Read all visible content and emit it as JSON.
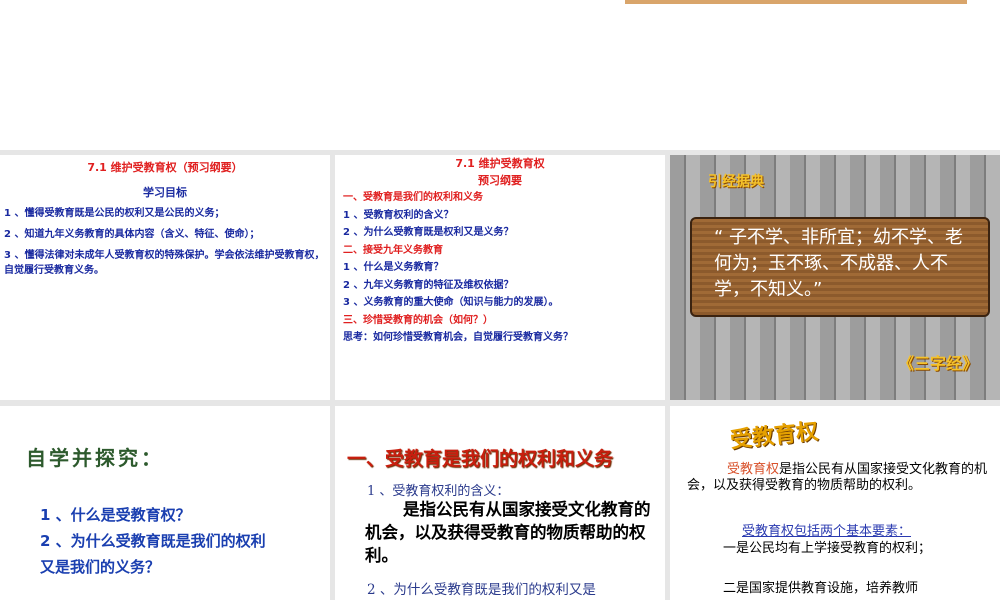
{
  "slide1": {
    "title": "7.1 维护受教育权（预习纲要）",
    "subtitle": "学习目标",
    "items": [
      "1 、懂得受教育既是公民的权利又是公民的义务；",
      "2 、知道九年义务教育的具体内容（含义、特征、使命）；",
      "3 、懂得法律对未成年人受教育权的特殊保护。学会依法维护受教育权，自觉履行受教育义务。"
    ]
  },
  "slide2": {
    "title": "7.1 维护受教育权",
    "subtitle": "预习纲要",
    "lines": [
      {
        "text": "一、受教育是我们的权利和义务",
        "color": "red"
      },
      {
        "text": "1 、受教育权利的含义？",
        "color": "blue"
      },
      {
        "text": "2 、为什么受教育既是权利又是义务？",
        "color": "blue"
      },
      {
        "text": "二、接受九年义务教育",
        "color": "red"
      },
      {
        "text": "1 、什么是义务教育？",
        "color": "blue"
      },
      {
        "text": "2 、九年义务教育的特征及维权依据？",
        "color": "blue"
      },
      {
        "text": "3 、义务教育的重大使命（知识与能力的发展）。",
        "color": "blue"
      },
      {
        "text": "三、珍惜受教育的机会（如何？）",
        "color": "red"
      },
      {
        "text": "思考：如何珍惜受教育机会，自觉履行受教育义务？",
        "color": "blue"
      }
    ]
  },
  "slide3": {
    "badge": "引经据典",
    "quote": "“ 子不学、非所宜；幼不学、老何为；玉不琢、不成器、人不学，不知义。”",
    "source": "《三字经》"
  },
  "slide4": {
    "heading": "自学并探究：",
    "q1": "1 、什么是受教育权？",
    "q2": "2 、为什么受教育既是我们的权利又是我们的义务？"
  },
  "slide5": {
    "heading": "一、受教育是我们的权利和义务",
    "sub1": "1 、受教育权利的含义：",
    "body": "是指公民有从国家接受文化教育的机会，以及获得受教育的物质帮助的权利。",
    "sub2": "2 、为什么受教育既是我们的权利又是"
  },
  "slide6": {
    "heading": "受教育权",
    "term": "受教育权",
    "definition": "是指公民有从国家接受文化教育的机会，以及获得受教育的物质帮助的权利。",
    "elements_title": "受教育权包括两个基本要素：",
    "element1": "一是公民均有上学接受教育的权利；",
    "element2": "二是国家提供教育设施，培养教师"
  }
}
